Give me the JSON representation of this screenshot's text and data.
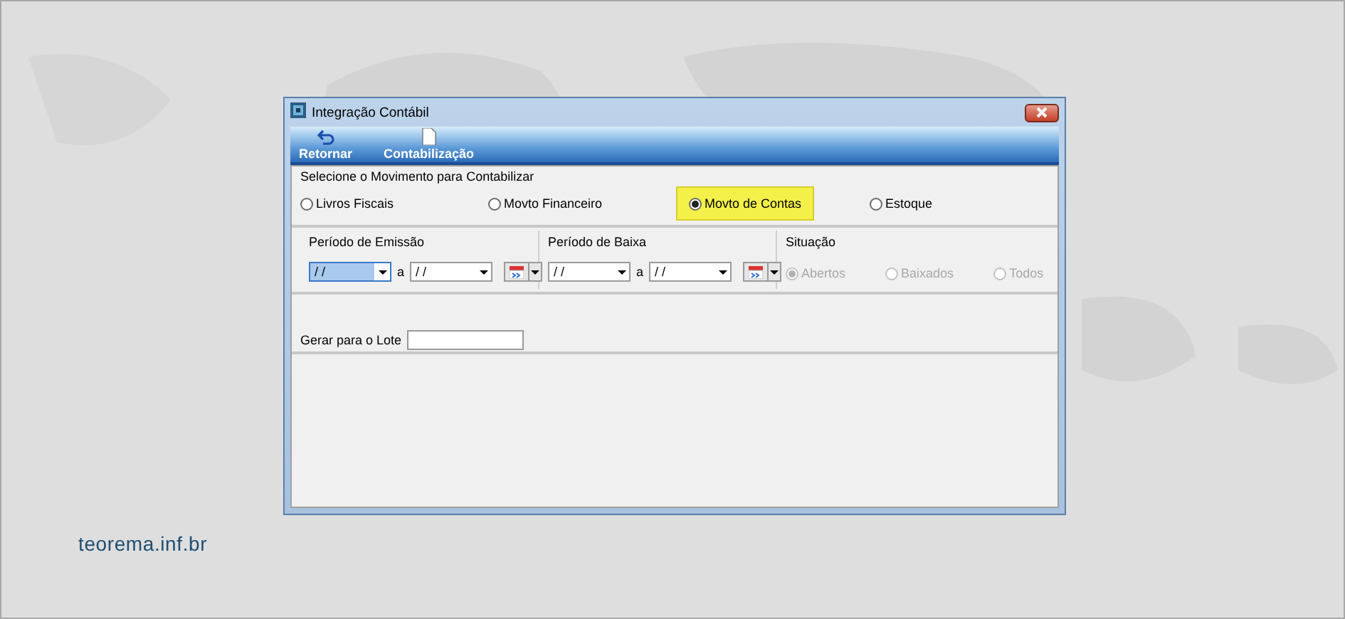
{
  "window": {
    "title": "Integração Contábil"
  },
  "toolbar": [
    {
      "kind": "back",
      "label": "Retornar"
    },
    {
      "kind": "document",
      "label": "Contabilização"
    }
  ],
  "movement": {
    "legend": "Selecione o Movimento para Contabilizar",
    "options": [
      {
        "label": "Livros Fiscais",
        "selected": false,
        "highlighted": false
      },
      {
        "label": "Movto Financeiro",
        "selected": false,
        "highlighted": false
      },
      {
        "label": "Movto de Contas",
        "selected": true,
        "highlighted": true
      },
      {
        "label": "Estoque",
        "selected": false,
        "highlighted": false
      }
    ]
  },
  "periods": [
    {
      "legend": "Período de Emissão",
      "from": {
        "value": "/ /",
        "focused": true
      },
      "separator": "a",
      "to": {
        "value": "/ /",
        "focused": false
      }
    },
    {
      "legend": "Período de Baixa",
      "from": {
        "value": "/ /",
        "focused": false
      },
      "separator": "a",
      "to": {
        "value": "/ /",
        "focused": false
      }
    }
  ],
  "situation": {
    "legend": "Situação",
    "options": [
      {
        "label": "Abertos",
        "selected": true,
        "disabled": true
      },
      {
        "label": "Baixados",
        "selected": false,
        "disabled": true
      },
      {
        "label": "Todos",
        "selected": false,
        "disabled": true
      }
    ]
  },
  "lote": {
    "label": "Gerar para o Lote"
  },
  "site_label": "teorema.inf.br"
}
